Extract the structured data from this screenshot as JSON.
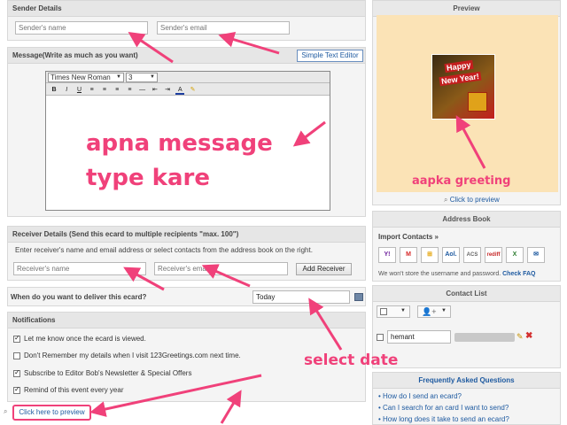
{
  "sender": {
    "header": "Sender Details",
    "name_placeholder": "Sender's name",
    "email_placeholder": "Sender's email"
  },
  "message": {
    "header": "Message(Write as much as you want)",
    "simple_editor_label": "Simple Text Editor",
    "font_family": "Times New Roman",
    "font_size": "3",
    "toolbar": [
      "B",
      "I",
      "U",
      "≡",
      "≡",
      "≡",
      "≡",
      "—",
      "⇤",
      "⇥",
      "A",
      "✎"
    ]
  },
  "receiver": {
    "header": "Receiver Details (Send this ecard to multiple recipients \"max. 100\")",
    "instruction": "Enter receiver's name and email address or select contacts from the address book on the right.",
    "name_placeholder": "Receiver's name",
    "email_placeholder": "Receiver's email",
    "add_label": "Add Receiver"
  },
  "deliver": {
    "label": "When do you want to deliver this ecard?",
    "value": "Today"
  },
  "notifications": {
    "header": "Notifications",
    "items": [
      {
        "label": "Let me know once the ecard is viewed.",
        "checked": true
      },
      {
        "label": "Don't Remember my details when I visit 123Greetings.com next time.",
        "checked": false
      },
      {
        "label": "Subscribe to Editor Bob's Newsletter & Special Offers",
        "checked": true
      },
      {
        "label": "Remind of this event every year",
        "checked": true
      }
    ]
  },
  "preview_link": "Click here to preview",
  "preview_panel": {
    "header": "Preview",
    "card_text_line1": "Happy",
    "card_text_line2": "New Year!",
    "click_label": "Click to preview"
  },
  "address_book": {
    "header": "Address Book",
    "import_label": "Import Contacts »",
    "providers": [
      "Y!",
      "M",
      "⊞",
      "Aol.",
      "ACS",
      "rediff",
      "X",
      "✉"
    ],
    "privacy_note": "We won't store the username and password.",
    "faq_link": "Check FAQ"
  },
  "contact_list": {
    "header": "Contact List",
    "contact_name": "hemant"
  },
  "faq": {
    "header": "Frequently Asked Questions",
    "items": [
      "How do I send an ecard?",
      "Can I search for an card I want to send?",
      "How long does it take to send an ecard?"
    ]
  },
  "annotations": {
    "message": [
      "apna message",
      "type kare"
    ],
    "greeting": "aapka greeting",
    "date": "select date"
  },
  "colors": {
    "annotation": "#f0417a",
    "link": "#1e5aa0",
    "preview_bg": "#fbe3b6"
  }
}
